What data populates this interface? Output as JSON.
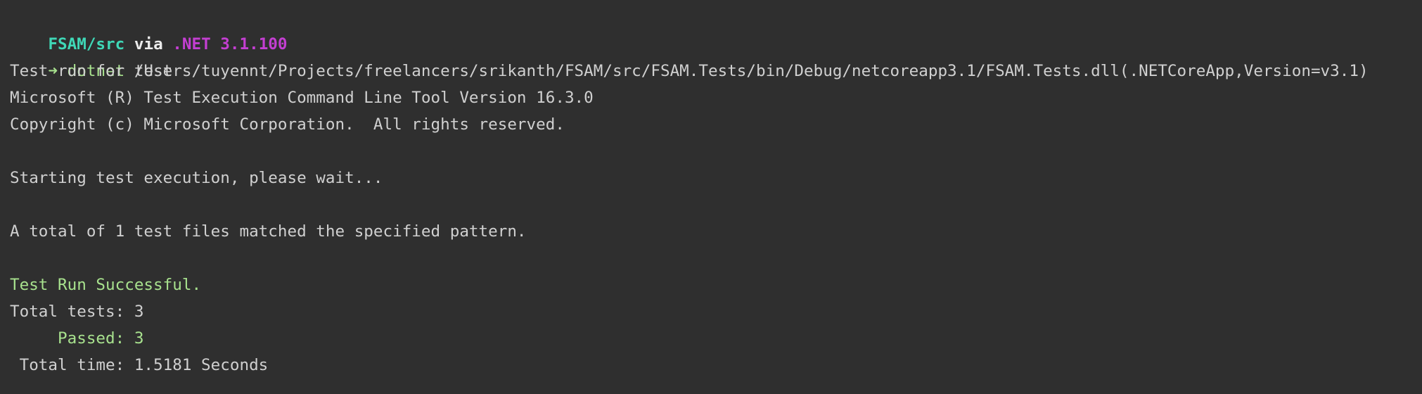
{
  "terminal": {
    "prompt": {
      "dir": "FSAM/src",
      "via": "via",
      "runtime": ".NET 3.1.100"
    },
    "command": {
      "arrow": "➜",
      "program": "dotnet",
      "args": "test"
    },
    "output": {
      "test_run_for": "Test run for /Users/tuyennt/Projects/freelancers/srikanth/FSAM/src/FSAM.Tests/bin/Debug/netcoreapp3.1/FSAM.Tests.dll(.NETCoreApp,Version=v3.1)",
      "tool_version": "Microsoft (R) Test Execution Command Line Tool Version 16.3.0",
      "copyright": "Copyright (c) Microsoft Corporation.  All rights reserved.",
      "starting": "Starting test execution, please wait...",
      "matched": "A total of 1 test files matched the specified pattern.",
      "result": "Test Run Successful.",
      "total_tests": "Total tests: 3",
      "passed": "     Passed: 3",
      "total_time": " Total time: 1.5181 Seconds"
    },
    "colors": {
      "background": "#2f2f2f",
      "dir": "#3fd8b7",
      "runtime": "#c43fd2",
      "success": "#a8e28e",
      "text": "#d0d0d0"
    }
  }
}
